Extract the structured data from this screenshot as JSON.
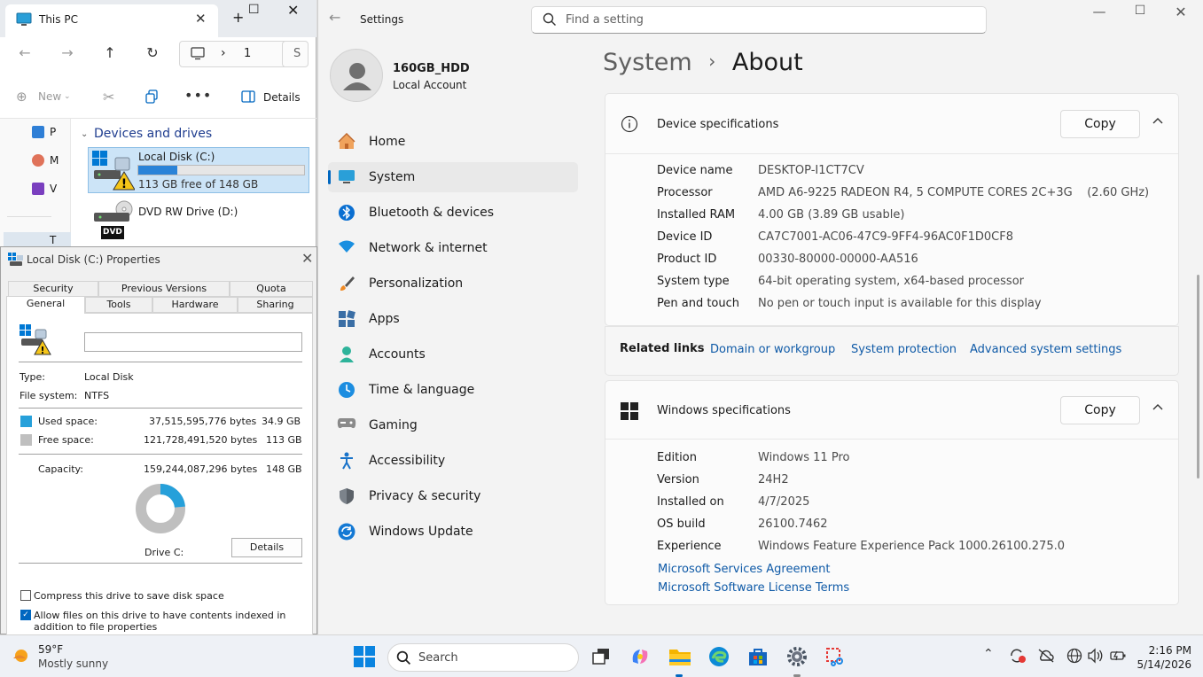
{
  "settings": {
    "title": "Settings",
    "search_placeholder": "Find a setting",
    "account": {
      "name": "160GB_HDD",
      "type": "Local Account"
    },
    "nav": [
      {
        "label": "Home",
        "icon": "home-icon",
        "selected": false
      },
      {
        "label": "System",
        "icon": "system-icon",
        "selected": true
      },
      {
        "label": "Bluetooth & devices",
        "icon": "bluetooth-icon",
        "selected": false
      },
      {
        "label": "Network & internet",
        "icon": "wifi-icon",
        "selected": false
      },
      {
        "label": "Personalization",
        "icon": "brush-icon",
        "selected": false
      },
      {
        "label": "Apps",
        "icon": "apps-icon",
        "selected": false
      },
      {
        "label": "Accounts",
        "icon": "person-icon",
        "selected": false
      },
      {
        "label": "Time & language",
        "icon": "globe-icon",
        "selected": false
      },
      {
        "label": "Gaming",
        "icon": "gamepad-icon",
        "selected": false
      },
      {
        "label": "Accessibility",
        "icon": "accessibility-icon",
        "selected": false
      },
      {
        "label": "Privacy & security",
        "icon": "shield-icon",
        "selected": false
      },
      {
        "label": "Windows Update",
        "icon": "update-icon",
        "selected": false
      }
    ],
    "breadcrumb": {
      "parent": "System",
      "separator": "›",
      "current": "About"
    },
    "device_specs": {
      "title": "Device specifications",
      "copy_label": "Copy",
      "rows": [
        {
          "label": "Device name",
          "value": "DESKTOP-I1CT7CV"
        },
        {
          "label": "Processor",
          "value": "AMD A6-9225 RADEON R4, 5 COMPUTE CORES 2C+3G    (2.60 GHz)"
        },
        {
          "label": "Installed RAM",
          "value": "4.00 GB (3.89 GB usable)"
        },
        {
          "label": "Device ID",
          "value": "CA7C7001-AC06-47C9-9FF4-96AC0F1D0CF8"
        },
        {
          "label": "Product ID",
          "value": "00330-80000-00000-AA516"
        },
        {
          "label": "System type",
          "value": "64-bit operating system, x64-based processor"
        },
        {
          "label": "Pen and touch",
          "value": "No pen or touch input is available for this display"
        }
      ]
    },
    "related": {
      "label": "Related links",
      "links": [
        "Domain or workgroup",
        "System protection",
        "Advanced system settings"
      ]
    },
    "windows_specs": {
      "title": "Windows specifications",
      "copy_label": "Copy",
      "rows": [
        {
          "label": "Edition",
          "value": "Windows 11 Pro"
        },
        {
          "label": "Version",
          "value": "24H2"
        },
        {
          "label": "Installed on",
          "value": "4/7/2025"
        },
        {
          "label": "OS build",
          "value": "26100.7462"
        },
        {
          "label": "Experience",
          "value": "Windows Feature Experience Pack 1000.26100.275.0"
        }
      ],
      "links": [
        "Microsoft Services Agreement",
        "Microsoft Software License Terms"
      ]
    }
  },
  "explorer": {
    "tab_title": "This PC",
    "address_parts": [
      "›",
      "1",
      "S"
    ],
    "toolbar": {
      "new_label": "New",
      "details_label": "Details"
    },
    "sidebar_letters": [
      "P",
      "M",
      "V",
      "T"
    ],
    "section_title": "Devices and drives",
    "drives": [
      {
        "name": "Local Disk (C:)",
        "free_text": "113 GB free of 148 GB",
        "used_fraction": 0.236,
        "badge": ""
      },
      {
        "name": "DVD RW Drive (D:)",
        "free_text": "",
        "badge": "DVD"
      }
    ]
  },
  "properties": {
    "title": "Local Disk (C:) Properties",
    "tabs_row1": [
      "Security",
      "Previous Versions",
      "Quota"
    ],
    "tabs_row2": [
      "General",
      "Tools",
      "Hardware",
      "Sharing"
    ],
    "active_tab": "General",
    "type_label": "Type:",
    "type_value": "Local Disk",
    "fs_label": "File system:",
    "fs_value": "NTFS",
    "used_label": "Used space:",
    "used_bytes": "37,515,595,776 bytes",
    "used_gb": "34.9 GB",
    "free_label": "Free space:",
    "free_bytes": "121,728,491,520 bytes",
    "free_gb": "113 GB",
    "cap_label": "Capacity:",
    "cap_bytes": "159,244,087,296 bytes",
    "cap_gb": "148 GB",
    "used_fraction": 0.236,
    "drive_label": "Drive C:",
    "details_btn": "Details",
    "compress_label": "Compress this drive to save disk space",
    "compress_checked": false,
    "index_label": "Allow files on this drive to have contents indexed in addition to file properties",
    "index_checked": true,
    "colors": {
      "used": "#26a0da",
      "free": "#bfbfbf"
    }
  },
  "taskbar": {
    "weather_temp": "59°F",
    "weather_desc": "Mostly sunny",
    "search_label": "Search",
    "time": "2:16 PM",
    "date": "5/14/2026"
  }
}
